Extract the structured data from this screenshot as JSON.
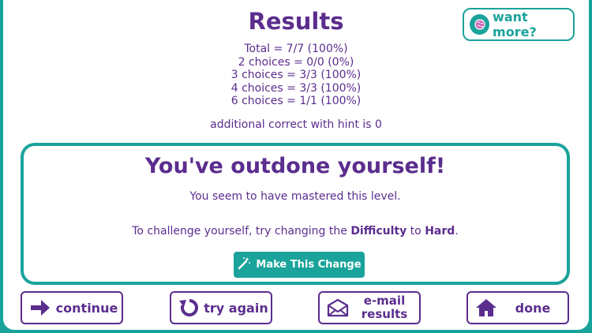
{
  "results": {
    "title": "Results",
    "stats": [
      "Total = 7/7 (100%)",
      "2 choices = 0/0 (0%)",
      "3 choices = 3/3 (100%)",
      "4 choices = 3/3 (100%)",
      "6 choices = 1/1 (100%)"
    ],
    "hint_line": "additional correct with hint is 0"
  },
  "want_more": {
    "label": "want more?",
    "icon": "brain-icon"
  },
  "panel": {
    "heading": "You've outdone yourself!",
    "line1": "You seem to have mastered this level.",
    "line2_prefix": "To challenge yourself, try changing the ",
    "line2_setting": "Difficulty",
    "line2_mid": " to ",
    "line2_value": "Hard",
    "line2_suffix": ".",
    "action_label": "Make This Change",
    "action_icon": "magic-wand-icon"
  },
  "buttons": {
    "continue": {
      "label": "continue",
      "icon": "arrow-right-icon"
    },
    "try_again": {
      "label": "try again",
      "icon": "retry-icon"
    },
    "email": {
      "label_line1": "e-mail",
      "label_line2": "results",
      "icon": "envelope-icon"
    },
    "done": {
      "label": "done",
      "icon": "home-icon"
    }
  },
  "colors": {
    "accent": "#1aa39b",
    "text": "#5b2d8e",
    "background": "#ffffff"
  }
}
